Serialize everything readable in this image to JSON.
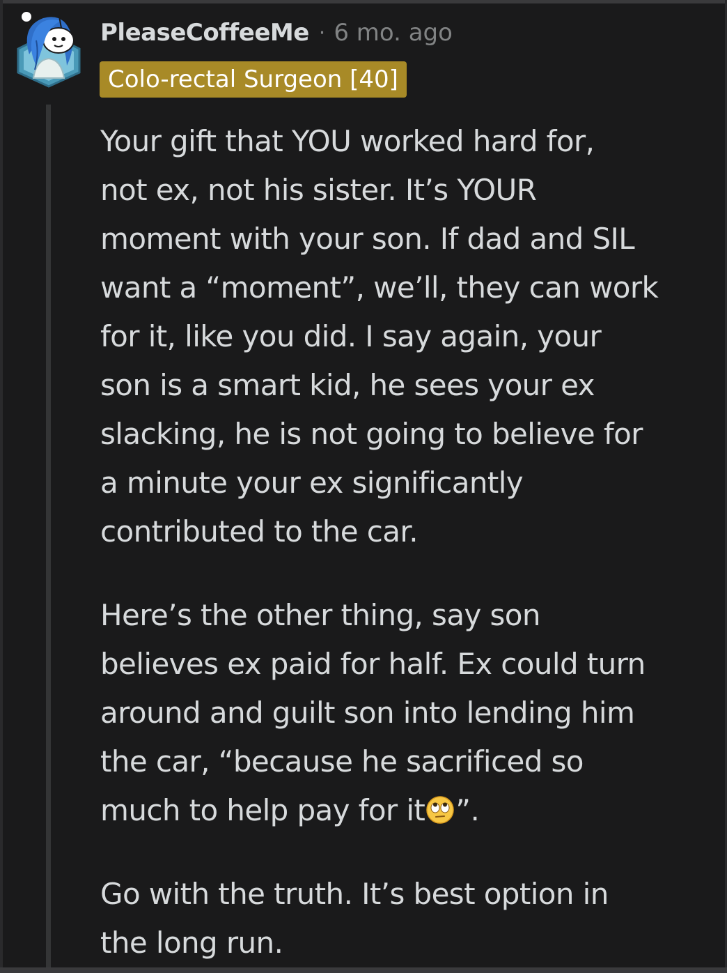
{
  "comment": {
    "username": "PleaseCoffeeMe",
    "separator": "·",
    "age": "6 mo. ago",
    "flair": "Colo-rectal Surgeon [40]",
    "emoji_name": "rolling-eyes-emoji",
    "paragraphs": [
      {
        "lines": [
          "Your gift that YOU worked hard for,",
          "not ex, not his sister. It’s YOUR",
          "moment with your son. If dad and SIL",
          "want a “moment”, we’ll, they can work",
          "for it, like you did. I say again, your",
          "son is a smart kid, he sees your ex",
          "slacking, he is not going to believe for",
          "a minute your ex significantly",
          "contributed to the car."
        ]
      },
      {
        "lines": [
          "Here’s the other thing, say son",
          "believes ex paid for half. Ex could turn",
          "around and guilt son into lending him",
          "the car, “because he sacrificed so"
        ],
        "emoji_line_before": "much to help pay for it",
        "emoji_line_after": "”."
      },
      {
        "lines": [
          "Go with the truth. It’s best option in",
          "the long run."
        ]
      }
    ]
  }
}
